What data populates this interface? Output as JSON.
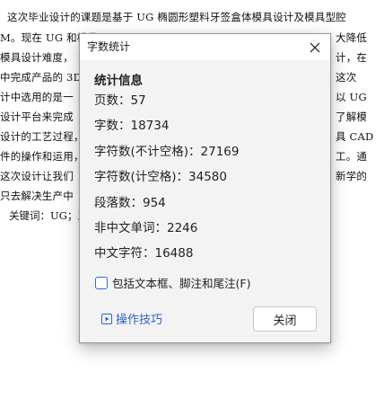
{
  "document": {
    "lines": [
      "这次毕业设计的课题是基于 UG 椭圆形塑料牙签盒体模具设计及模具型腔",
      "M。现在 UG 和模具",
      "模具设计难度，",
      "中完成产品的 3D",
      "计中选用的是一",
      "设计平台来完成",
      "设计的工艺过程，",
      "件的操作和运用，",
      "这次设计让我们",
      "只去解决生产中",
      "关键词：UG；牙"
    ],
    "right_fragments": [
      "大降低",
      "计，在",
      "这次",
      "以 UG",
      "了解模",
      "具 CAD",
      "工。通",
      "新学的"
    ]
  },
  "dialog": {
    "title": "字数统计",
    "section_title": "统计信息",
    "stats": [
      "页数：57",
      "字数：18734",
      "字符数(不计空格)：27169",
      "字符数(计空格)：34580",
      "段落数：954",
      "非中文单词：2246",
      "中文字符：16488"
    ],
    "checkbox_label": "包括文本框、脚注和尾注(F)",
    "checkbox_checked": false,
    "tips_label": "操作技巧",
    "close_label": "关闭"
  },
  "colors": {
    "accent": "#2f63c6",
    "dialog_bg": "#f3f3f3"
  }
}
